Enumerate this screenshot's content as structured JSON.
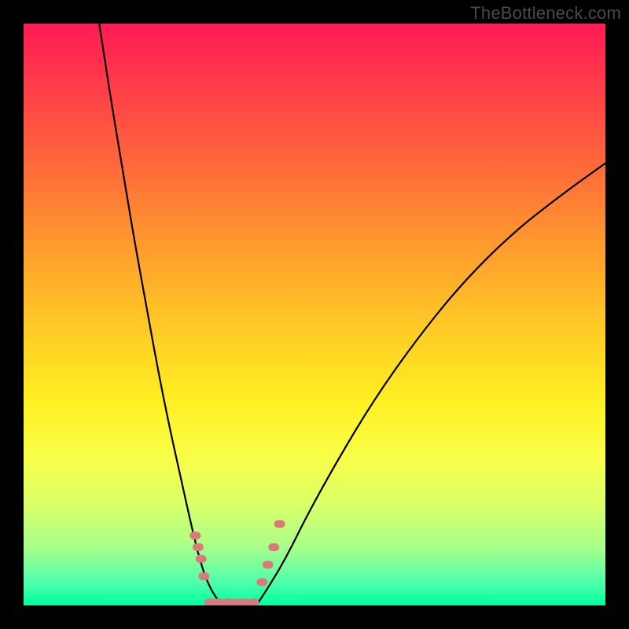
{
  "watermark": "TheBottleneck.com",
  "chart_data": {
    "type": "line",
    "title": "",
    "xlabel": "",
    "ylabel": "",
    "xlim": [
      0,
      100
    ],
    "ylim": [
      0,
      100
    ],
    "series": [
      {
        "name": "left-curve",
        "x": [
          13,
          15,
          17,
          19,
          21,
          23,
          25,
          27,
          29,
          30.5,
          32,
          34
        ],
        "y": [
          100,
          87,
          75,
          63,
          52,
          41,
          31,
          22,
          13,
          7,
          3,
          0
        ]
      },
      {
        "name": "right-curve",
        "x": [
          40,
          42,
          45,
          49,
          54,
          60,
          67,
          75,
          84,
          93,
          100
        ],
        "y": [
          0,
          3,
          8,
          16,
          25,
          35,
          45,
          55,
          64,
          71,
          76
        ]
      },
      {
        "name": "flat-bottom",
        "x": [
          34,
          40
        ],
        "y": [
          0,
          0
        ]
      }
    ],
    "markers": [
      {
        "name": "left-cluster",
        "x": [
          29.5,
          30,
          30.5,
          31
        ],
        "y": [
          12,
          10,
          8,
          5
        ]
      },
      {
        "name": "bottom-cluster",
        "x": [
          32,
          33.5,
          35,
          36.5,
          38,
          39.5
        ],
        "y": [
          0.5,
          0.5,
          0.5,
          0.5,
          0.5,
          0.5
        ]
      },
      {
        "name": "right-cluster",
        "x": [
          41,
          42,
          43,
          44
        ],
        "y": [
          4,
          7,
          10,
          14
        ]
      }
    ],
    "marker_color": "#d97b7b",
    "curve_color": "#000000"
  }
}
